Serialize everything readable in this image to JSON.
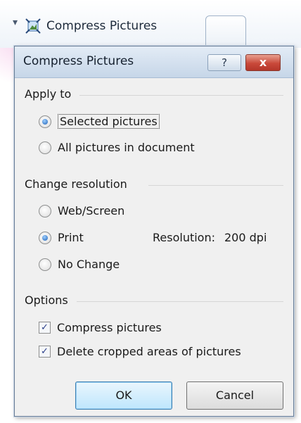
{
  "ribbon": {
    "button_label": "Compress Pictures",
    "icon": "compress-pictures-icon"
  },
  "dialog": {
    "title": "Compress Pictures",
    "help_label": "?",
    "close_label": "x"
  },
  "apply_to": {
    "label": "Apply to",
    "selected_label": "Selected pictures",
    "all_label": "All pictures in document",
    "selected": "selected"
  },
  "change_resolution": {
    "label": "Change resolution",
    "web_label": "Web/Screen",
    "print_label": "Print",
    "no_change_label": "No Change",
    "selected": "print",
    "resolution_label": "Resolution:",
    "resolution_value": "200 dpi"
  },
  "options": {
    "label": "Options",
    "compress_label": "Compress pictures",
    "compress_checked": true,
    "delete_cropped_label": "Delete cropped areas of pictures",
    "delete_cropped_checked": true
  },
  "buttons": {
    "ok_label": "OK",
    "cancel_label": "Cancel"
  },
  "colors": {
    "dialog_bg": "#f0f0f0",
    "titlebar": "#c6d6e8",
    "close_button": "#c9493a",
    "radio_dot": "#1c5fb5",
    "default_button": "#bee6fd"
  }
}
